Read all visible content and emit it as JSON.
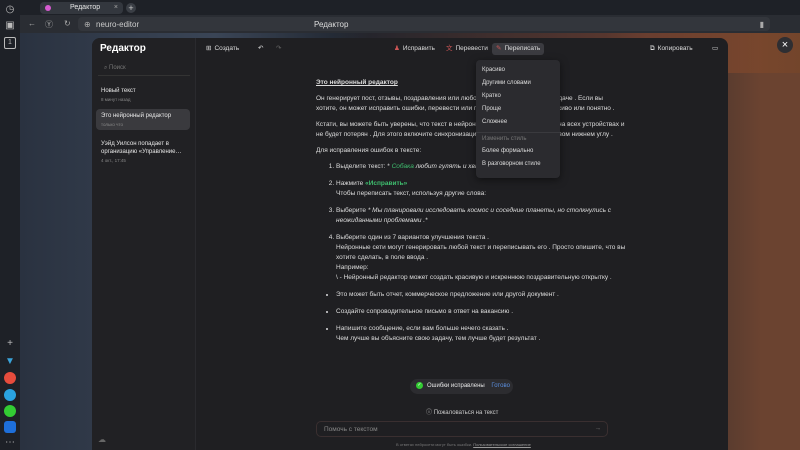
{
  "browser": {
    "tab_title": "Редактор",
    "url": "neuro-editor",
    "page_title": "Редактор",
    "tab_count": "1"
  },
  "sidebar": {
    "logo": "Редактор",
    "search_placeholder": "Поиск",
    "items": [
      {
        "title": "Новый текст",
        "meta": "8 минут назад"
      },
      {
        "title": "Это нейронный редактор",
        "meta": "только что"
      },
      {
        "title": "Уэйд Уилсон попадает в организацию «Управление…",
        "meta": "4 окт., 17:45"
      }
    ]
  },
  "toolbar": {
    "create": "Создать",
    "fix": "Исправить",
    "translate": "Перевести",
    "rewrite": "Переписать",
    "copy": "Копировать"
  },
  "menu": {
    "items": [
      "Красиво",
      "Другими словами",
      "Кратко",
      "Проще",
      "Сложнее"
    ],
    "style_header": "Изменить стиль",
    "style_items": [
      "Более формально",
      "В разговорном стиле"
    ]
  },
  "doc": {
    "title": "Это нейронный редактор",
    "p1": "Он генерирует пост, отзывы, поздравления или любой другой текст по вашей задаче . Если вы хотите, он может исправить ошибки, перевести или переписать текст более красиво или понятно .",
    "p2": "Кстати, вы можете быть уверены, что текст в нейронном редакторе сохранится на всех устройствах и не будет потерян . Для этого включите синхронизацию — кнопка с облаком в левом нижнем углу .",
    "p3": "Для исправления ошибок в тексте:",
    "s1_a": "Выделите текст: * ",
    "s1_g": "Собака",
    "s1_b": " любит гулять и хвастаться этим .*",
    "s2_a": "Нажмите ",
    "s2_b": "«Исправить»",
    "s2_c": "Чтобы переписать текст, используя другие слова:",
    "s3_a": "Выберите ",
    "s3_b": "* Мы планировали исследовать космос и соседние планеты, но столкнулись с неожиданными проблемами .*",
    "s4_a": "Выберите один из 7 вариантов улучшения текста .",
    "s4_b": "Нейронные сети могут генерировать любой текст и переписывать его . Просто опишите, что вы хотите сделать, в поле ввода .",
    "s4_c": "Например:",
    "s4_d": "\\ - Нейронный редактор может создать красивую и искреннюю поздравительную открытку .",
    "b1": "Это может быть отчет, коммерческое предложение или другой документ .",
    "b2": "Создайте сопроводительное письмо в ответ на вакансию .",
    "b3_a": "Напишите сообщение, если вам больше нечего сказать .",
    "b3_b": "Чем лучше вы объясните свою задачу, тем лучше будет результат ."
  },
  "status": {
    "text": "Ошибки исправлены",
    "done": "Готово"
  },
  "report": "Пожаловаться на текст",
  "input": {
    "placeholder": "Помочь с текстом"
  },
  "footer": {
    "text": "В ответах нейросети могут быть ошибки.",
    "link": "Пользовательское соглашение"
  }
}
